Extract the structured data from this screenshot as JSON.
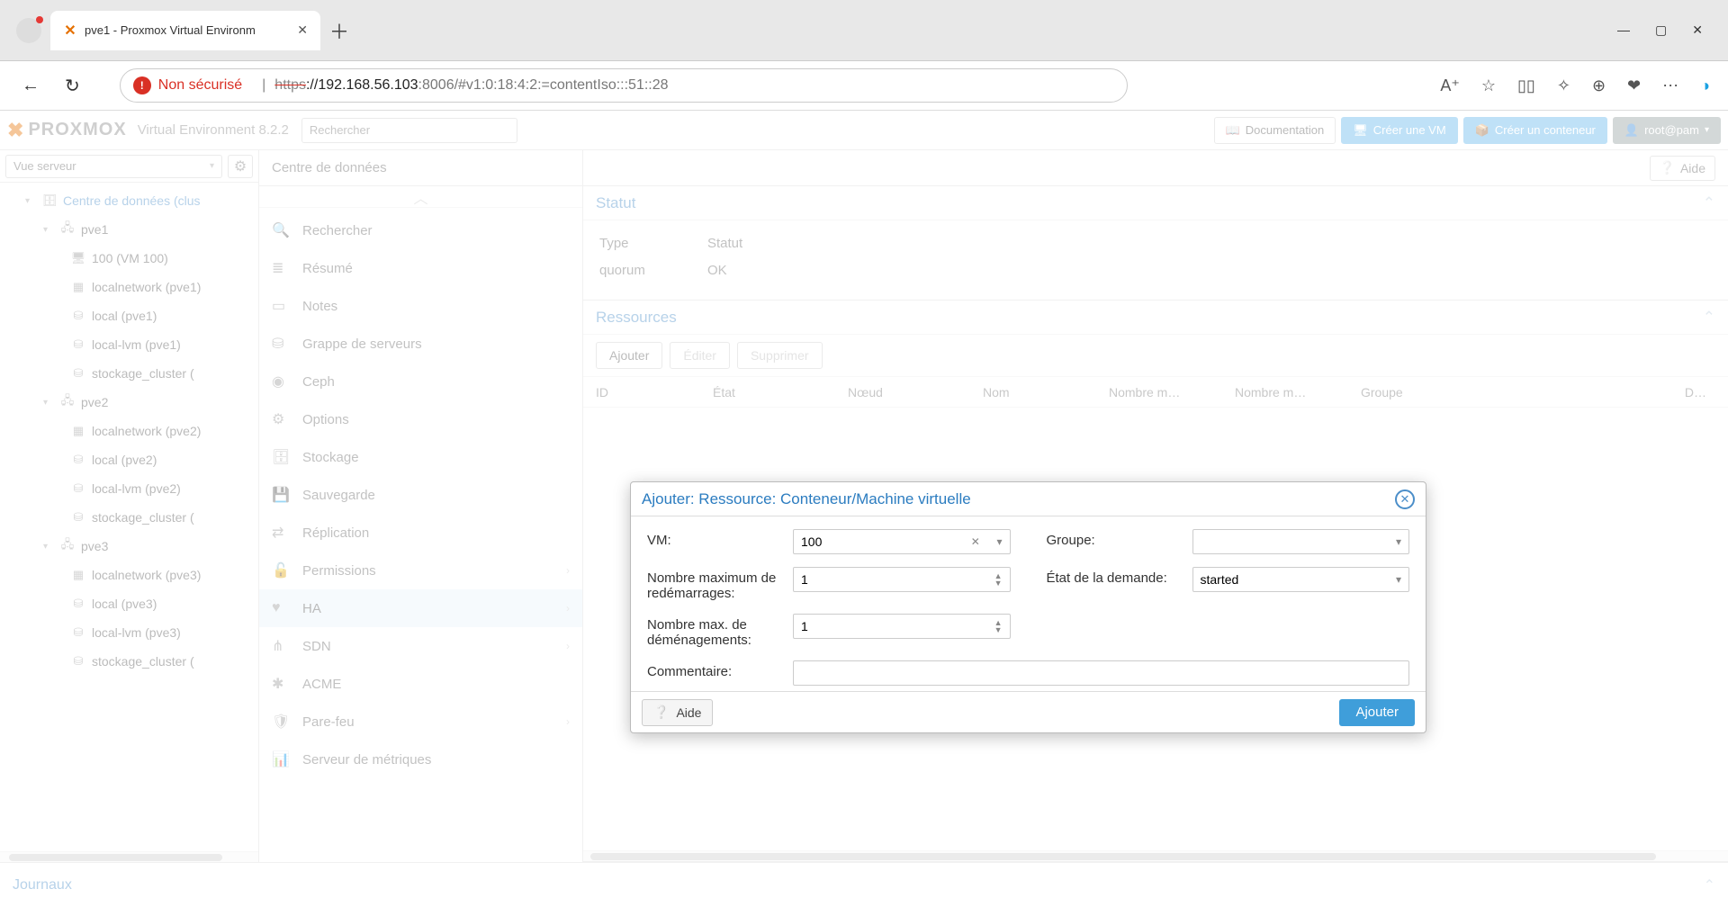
{
  "browser": {
    "tab_title": "pve1 - Proxmox Virtual Environm",
    "insecure_label": "Non sécurisé",
    "url_protocol": "https",
    "url_host": "://192.168.56.103",
    "url_path": ":8006/#v1:0:18:4:2:=contentIso:::51::28"
  },
  "header": {
    "logo_text": "PROXMOX",
    "version": "Virtual Environment 8.2.2",
    "search_placeholder": "Rechercher",
    "doc_label": "Documentation",
    "create_vm": "Créer une VM",
    "create_ct": "Créer un conteneur",
    "user": "root@pam"
  },
  "sidebar": {
    "view_label": "Vue serveur",
    "tree": {
      "dc": "Centre de données (clus",
      "nodes": [
        {
          "name": "pve1",
          "children": [
            "100 (VM 100)",
            "localnetwork (pve1)",
            "local (pve1)",
            "local-lvm (pve1)",
            "stockage_cluster ("
          ]
        },
        {
          "name": "pve2",
          "children": [
            "localnetwork (pve2)",
            "local (pve2)",
            "local-lvm (pve2)",
            "stockage_cluster ("
          ]
        },
        {
          "name": "pve3",
          "children": [
            "localnetwork (pve3)",
            "local (pve3)",
            "local-lvm (pve3)",
            "stockage_cluster ("
          ]
        }
      ]
    }
  },
  "crumb": "Centre de données",
  "help_label": "Aide",
  "submenu": {
    "items": [
      {
        "icon": "🔍",
        "label": "Rechercher"
      },
      {
        "icon": "≣",
        "label": "Résumé"
      },
      {
        "icon": "▭",
        "label": "Notes"
      },
      {
        "icon": "⛁",
        "label": "Grappe de serveurs"
      },
      {
        "icon": "◉",
        "label": "Ceph"
      },
      {
        "icon": "⚙",
        "label": "Options"
      },
      {
        "icon": "🗄",
        "label": "Stockage"
      },
      {
        "icon": "💾",
        "label": "Sauvegarde"
      },
      {
        "icon": "⇄",
        "label": "Réplication"
      },
      {
        "icon": "🔓",
        "label": "Permissions",
        "expand": true
      },
      {
        "icon": "♥",
        "label": "HA",
        "selected": true,
        "expand": true
      },
      {
        "icon": "⋔",
        "label": "SDN",
        "expand": true
      },
      {
        "icon": "✱",
        "label": "ACME"
      },
      {
        "icon": "🛡",
        "label": "Pare-feu",
        "expand": true
      },
      {
        "icon": "📊",
        "label": "Serveur de métriques"
      }
    ]
  },
  "status_panel": {
    "title": "Statut",
    "rows": [
      {
        "k": "Type",
        "v": "Statut"
      },
      {
        "k": "quorum",
        "v": "OK"
      }
    ]
  },
  "resources_panel": {
    "title": "Ressources",
    "buttons": {
      "add": "Ajouter",
      "edit": "Éditer",
      "remove": "Supprimer"
    },
    "columns": [
      "ID",
      "État",
      "Nœud",
      "Nom",
      "Nombre m…",
      "Nombre m…",
      "Groupe",
      "D…"
    ]
  },
  "footer_label": "Journaux",
  "modal": {
    "title": "Ajouter: Ressource: Conteneur/Machine virtuelle",
    "fields": {
      "vm_label": "VM:",
      "vm_value": "100",
      "group_label": "Groupe:",
      "group_value": "",
      "restart_label": "Nombre maximum de redémarrages:",
      "restart_value": "1",
      "state_label": "État de la demande:",
      "state_value": "started",
      "relocate_label": "Nombre max. de déménagements:",
      "relocate_value": "1",
      "comment_label": "Commentaire:",
      "comment_value": ""
    },
    "help": "Aide",
    "submit": "Ajouter"
  }
}
